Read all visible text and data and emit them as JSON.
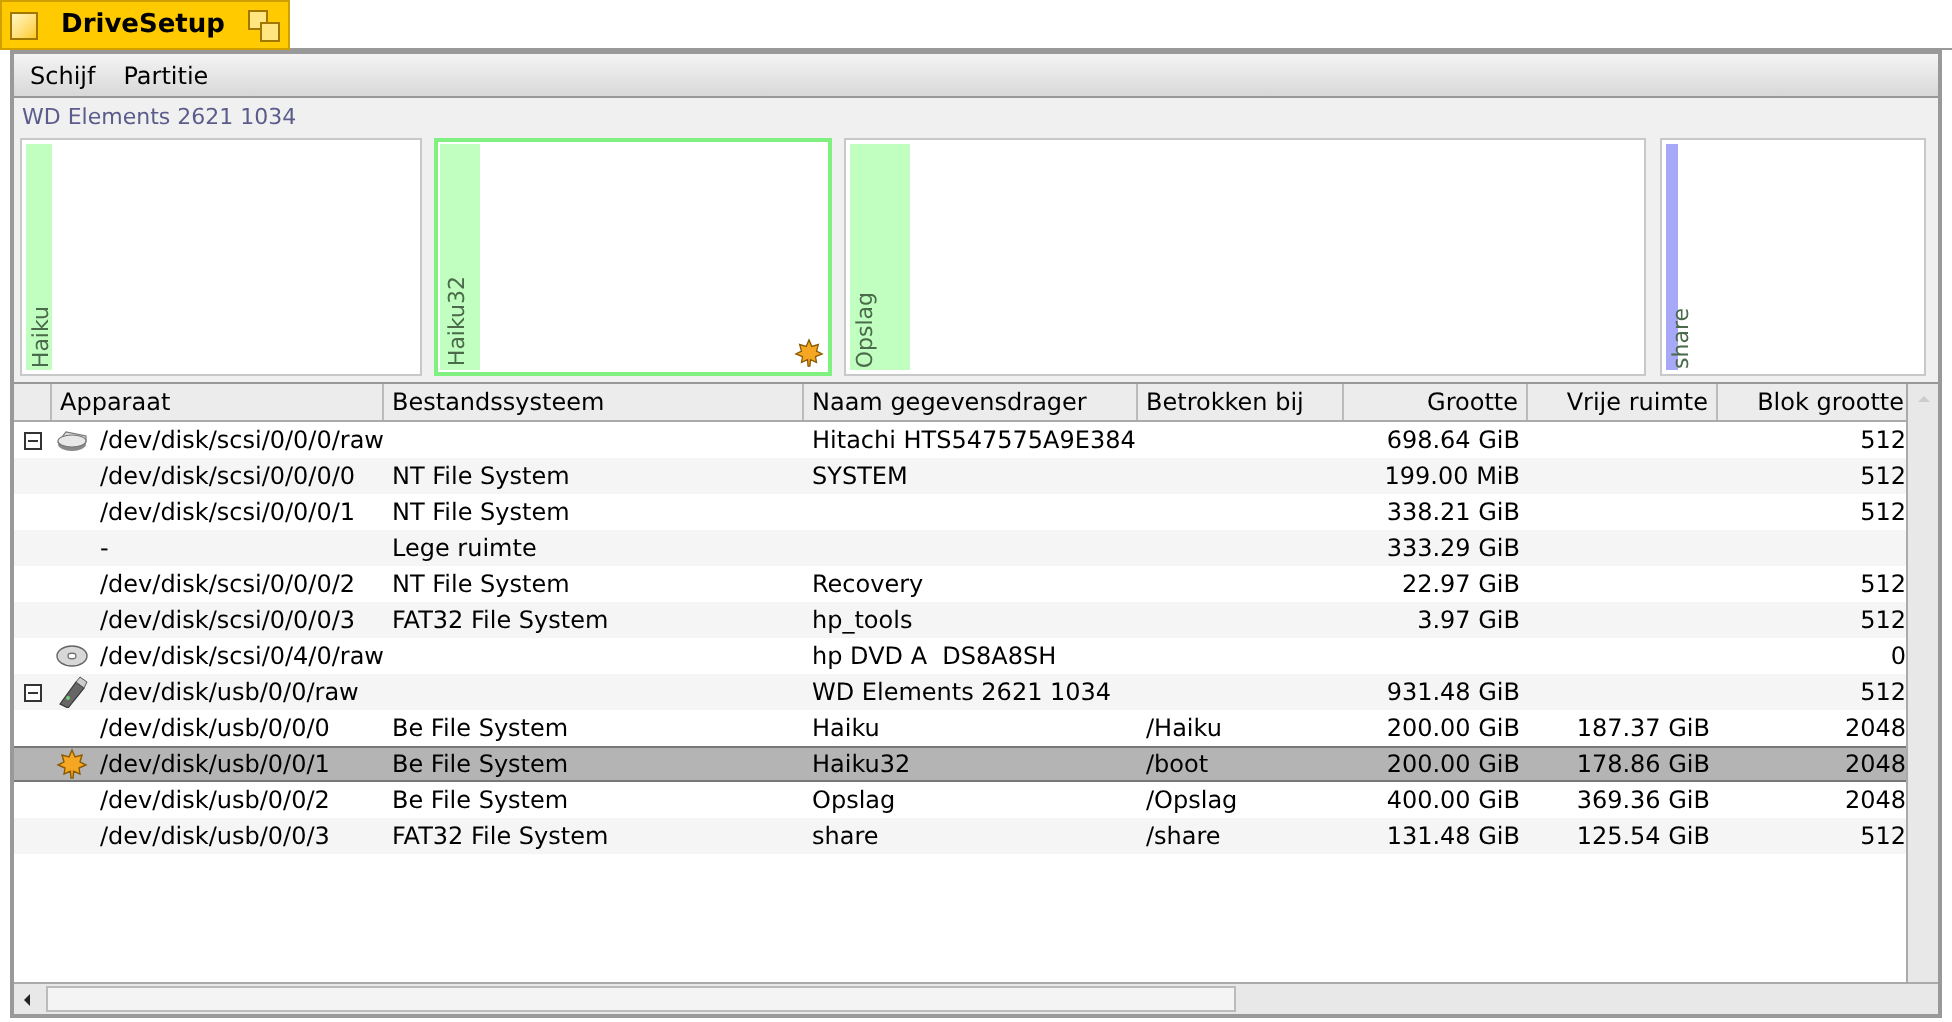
{
  "window": {
    "title": "DriveSetup"
  },
  "menu": [
    "Schijf",
    "Partitie"
  ],
  "disk_map": {
    "title": "WD Elements 2621 1034",
    "partitions": [
      {
        "label": "Haiku",
        "color": "#c0ffc0",
        "level": 0.063,
        "selected": false,
        "boot": false
      },
      {
        "label": "Haiku32",
        "color": "#c0ffc0",
        "level": 0.106,
        "selected": true,
        "boot": true
      },
      {
        "label": "Opslag",
        "color": "#c0ffc0",
        "level": 0.077,
        "selected": false,
        "boot": false
      },
      {
        "label": "share",
        "color": "#a8a8f8",
        "level": 0.045,
        "selected": false,
        "boot": false
      }
    ]
  },
  "table": {
    "columns": [
      "Apparaat",
      "Bestandssysteem",
      "Naam gegevensdrager",
      "Betrokken bij",
      "Grootte",
      "Vrije ruimte",
      "Blok grootte"
    ],
    "rows": [
      {
        "kind": "disk",
        "expanded": true,
        "selected": false,
        "cells": [
          "/dev/disk/scsi/0/0/0/raw",
          "",
          "Hitachi HTS547575A9E384",
          "",
          "698.64 GiB",
          "",
          "512"
        ],
        "children": [
          {
            "kind": "partition",
            "selected": false,
            "cells": [
              "/dev/disk/scsi/0/0/0/0",
              "NT File System",
              "SYSTEM",
              "",
              "199.00 MiB",
              "",
              "512"
            ]
          },
          {
            "kind": "partition",
            "selected": false,
            "cells": [
              "/dev/disk/scsi/0/0/0/1",
              "NT File System",
              "",
              "",
              "338.21 GiB",
              "",
              "512"
            ]
          },
          {
            "kind": "partition",
            "selected": false,
            "cells": [
              "-",
              "Lege ruimte",
              "",
              "",
              "333.29 GiB",
              "",
              ""
            ]
          },
          {
            "kind": "partition",
            "selected": false,
            "cells": [
              "/dev/disk/scsi/0/0/0/2",
              "NT File System",
              "Recovery",
              "",
              "22.97 GiB",
              "",
              "512"
            ]
          },
          {
            "kind": "partition",
            "selected": false,
            "cells": [
              "/dev/disk/scsi/0/0/0/3",
              "FAT32 File System",
              "hp_tools",
              "",
              "3.97 GiB",
              "",
              "512"
            ]
          }
        ]
      },
      {
        "kind": "cd",
        "selected": false,
        "cells": [
          "/dev/disk/scsi/0/4/0/raw",
          "",
          "hp DVD A  DS8A8SH",
          "",
          "",
          "",
          "0"
        ]
      },
      {
        "kind": "usb",
        "expanded": true,
        "selected": false,
        "cells": [
          "/dev/disk/usb/0/0/raw",
          "",
          "WD Elements 2621 1034",
          "",
          "931.48 GiB",
          "",
          "512"
        ],
        "children": [
          {
            "kind": "partition",
            "selected": false,
            "cells": [
              "/dev/disk/usb/0/0/0",
              "Be File System",
              "Haiku",
              "/Haiku",
              "200.00 GiB",
              "187.37 GiB",
              "2048"
            ]
          },
          {
            "kind": "boot",
            "selected": true,
            "cells": [
              "/dev/disk/usb/0/0/1",
              "Be File System",
              "Haiku32",
              "/boot",
              "200.00 GiB",
              "178.86 GiB",
              "2048"
            ]
          },
          {
            "kind": "partition",
            "selected": false,
            "cells": [
              "/dev/disk/usb/0/0/2",
              "Be File System",
              "Opslag",
              "/Opslag",
              "400.00 GiB",
              "369.36 GiB",
              "2048"
            ]
          },
          {
            "kind": "partition",
            "selected": false,
            "cells": [
              "/dev/disk/usb/0/0/3",
              "FAT32 File System",
              "share",
              "/share",
              "131.48 GiB",
              "125.54 GiB",
              "512"
            ]
          }
        ]
      }
    ]
  }
}
